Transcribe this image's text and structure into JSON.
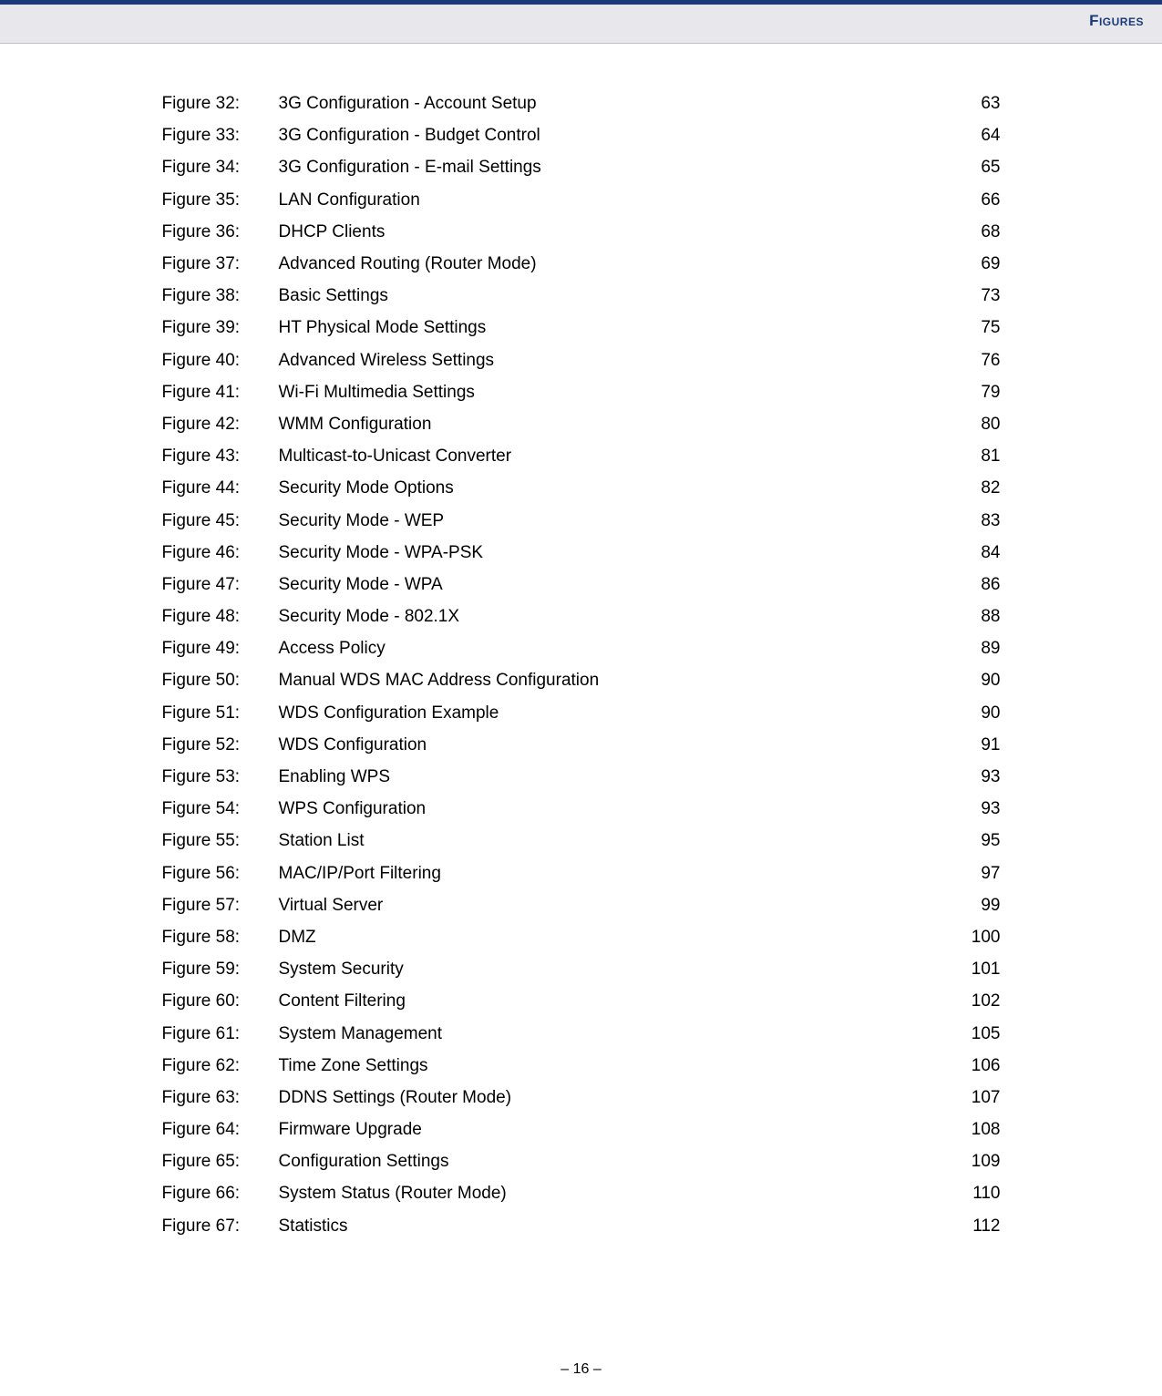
{
  "header": {
    "title": "Figures"
  },
  "figures": [
    {
      "label": "Figure 32:",
      "title": "3G Configuration - Account Setup",
      "page": "63"
    },
    {
      "label": "Figure 33:",
      "title": "3G Configuration - Budget Control",
      "page": "64"
    },
    {
      "label": "Figure 34:",
      "title": "3G Configuration - E-mail Settings",
      "page": "65"
    },
    {
      "label": "Figure 35:",
      "title": "LAN Configuration",
      "page": "66"
    },
    {
      "label": "Figure 36:",
      "title": "DHCP Clients",
      "page": "68"
    },
    {
      "label": "Figure 37:",
      "title": "Advanced Routing (Router Mode)",
      "page": "69"
    },
    {
      "label": "Figure 38:",
      "title": "Basic Settings",
      "page": "73"
    },
    {
      "label": "Figure 39:",
      "title": "HT Physical Mode Settings",
      "page": "75"
    },
    {
      "label": "Figure 40:",
      "title": "Advanced Wireless Settings",
      "page": "76"
    },
    {
      "label": "Figure 41:",
      "title": "Wi-Fi Multimedia Settings",
      "page": "79"
    },
    {
      "label": "Figure 42:",
      "title": "WMM Configuration",
      "page": "80"
    },
    {
      "label": "Figure 43:",
      "title": "Multicast-to-Unicast Converter",
      "page": "81"
    },
    {
      "label": "Figure 44:",
      "title": "Security Mode Options",
      "page": "82"
    },
    {
      "label": "Figure 45:",
      "title": "Security Mode - WEP",
      "page": "83"
    },
    {
      "label": "Figure 46:",
      "title": "Security Mode - WPA-PSK",
      "page": "84"
    },
    {
      "label": "Figure 47:",
      "title": "Security Mode - WPA",
      "page": "86"
    },
    {
      "label": "Figure 48:",
      "title": "Security Mode - 802.1X",
      "page": "88"
    },
    {
      "label": "Figure 49:",
      "title": "Access Policy",
      "page": "89"
    },
    {
      "label": "Figure 50:",
      "title": "Manual WDS MAC Address Configuration",
      "page": "90"
    },
    {
      "label": "Figure 51:",
      "title": "WDS Configuration Example",
      "page": "90"
    },
    {
      "label": "Figure 52:",
      "title": "WDS Configuration",
      "page": "91"
    },
    {
      "label": "Figure 53:",
      "title": "Enabling WPS",
      "page": "93"
    },
    {
      "label": "Figure 54:",
      "title": "WPS Configuration",
      "page": "93"
    },
    {
      "label": "Figure 55:",
      "title": "Station List",
      "page": "95"
    },
    {
      "label": "Figure 56:",
      "title": "MAC/IP/Port Filtering",
      "page": "97"
    },
    {
      "label": "Figure 57:",
      "title": "Virtual Server",
      "page": "99"
    },
    {
      "label": "Figure 58:",
      "title": "DMZ",
      "page": "100"
    },
    {
      "label": "Figure 59:",
      "title": "System Security",
      "page": "101"
    },
    {
      "label": "Figure 60:",
      "title": "Content Filtering",
      "page": "102"
    },
    {
      "label": "Figure 61:",
      "title": "System Management",
      "page": "105"
    },
    {
      "label": "Figure 62:",
      "title": "Time Zone Settings",
      "page": "106"
    },
    {
      "label": "Figure 63:",
      "title": "DDNS Settings (Router Mode)",
      "page": "107"
    },
    {
      "label": "Figure 64:",
      "title": "Firmware Upgrade",
      "page": "108"
    },
    {
      "label": "Figure 65:",
      "title": "Configuration Settings",
      "page": "109"
    },
    {
      "label": "Figure 66:",
      "title": "System Status (Router Mode)",
      "page": "110"
    },
    {
      "label": "Figure 67:",
      "title": "Statistics",
      "page": "112"
    }
  ],
  "footer": {
    "page_indicator": "–  16  –"
  }
}
